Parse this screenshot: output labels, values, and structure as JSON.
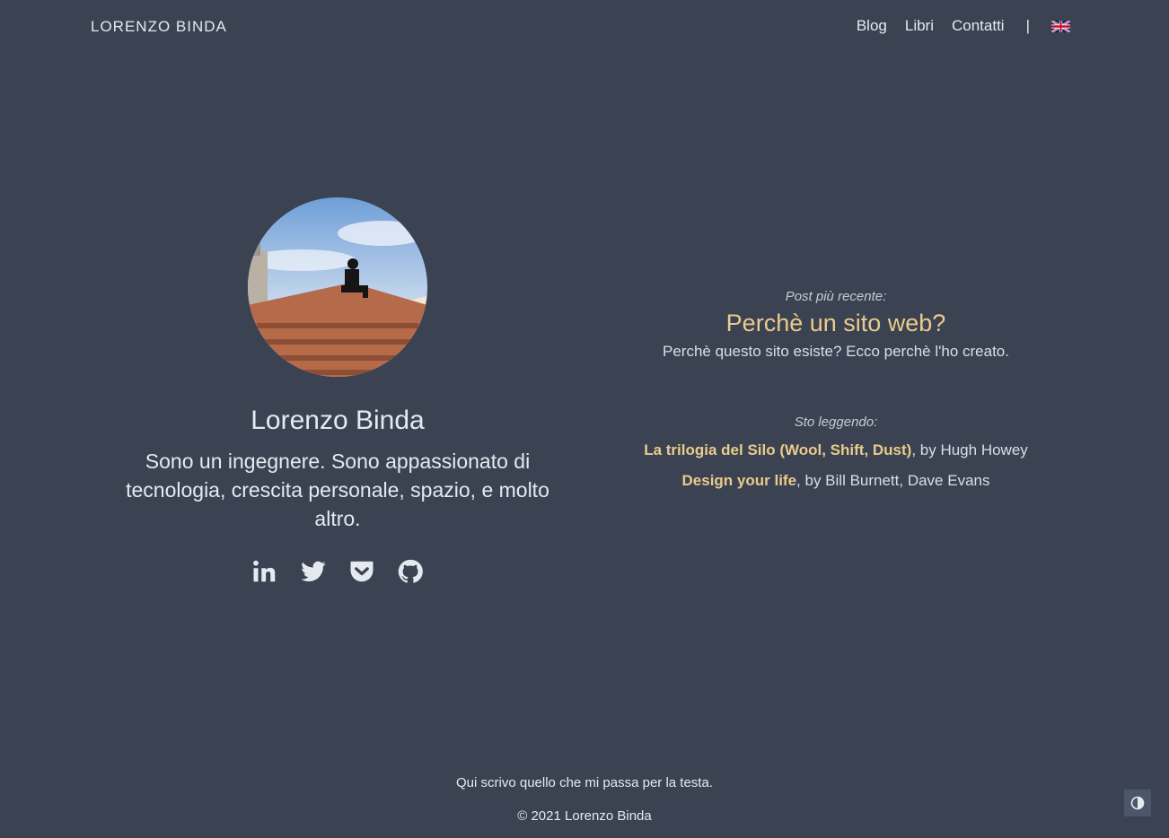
{
  "nav": {
    "brand": "LORENZO BINDA",
    "links": [
      "Blog",
      "Libri",
      "Contatti"
    ],
    "separator": "|",
    "language_icon": "uk-flag-icon"
  },
  "profile": {
    "name": "Lorenzo Binda",
    "bio": "Sono un ingegnere. Sono appassionato di tecnologia, crescita personale, spazio, e molto altro.",
    "socials": [
      "linkedin-icon",
      "twitter-icon",
      "pocket-icon",
      "github-icon"
    ]
  },
  "latest_post": {
    "kicker": "Post più recente:",
    "title": "Perchè un sito web?",
    "subtitle": "Perchè questo sito esiste? Ecco perchè l'ho creato."
  },
  "reading": {
    "kicker": "Sto leggendo:",
    "books": [
      {
        "title": "La trilogia del Silo (Wool, Shift, Dust)",
        "author": ", by Hugh Howey"
      },
      {
        "title": "Design your life",
        "author": ", by Bill Burnett, Dave Evans"
      }
    ]
  },
  "footer": {
    "tagline": "Qui scrivo quello che mi passa per la testa.",
    "copyright": "© 2021 Lorenzo Binda"
  },
  "theme_toggle_icon": "contrast-icon",
  "colors": {
    "background": "#3b4252",
    "accent": "#ebcb8b",
    "text": "#e5e9f0"
  }
}
